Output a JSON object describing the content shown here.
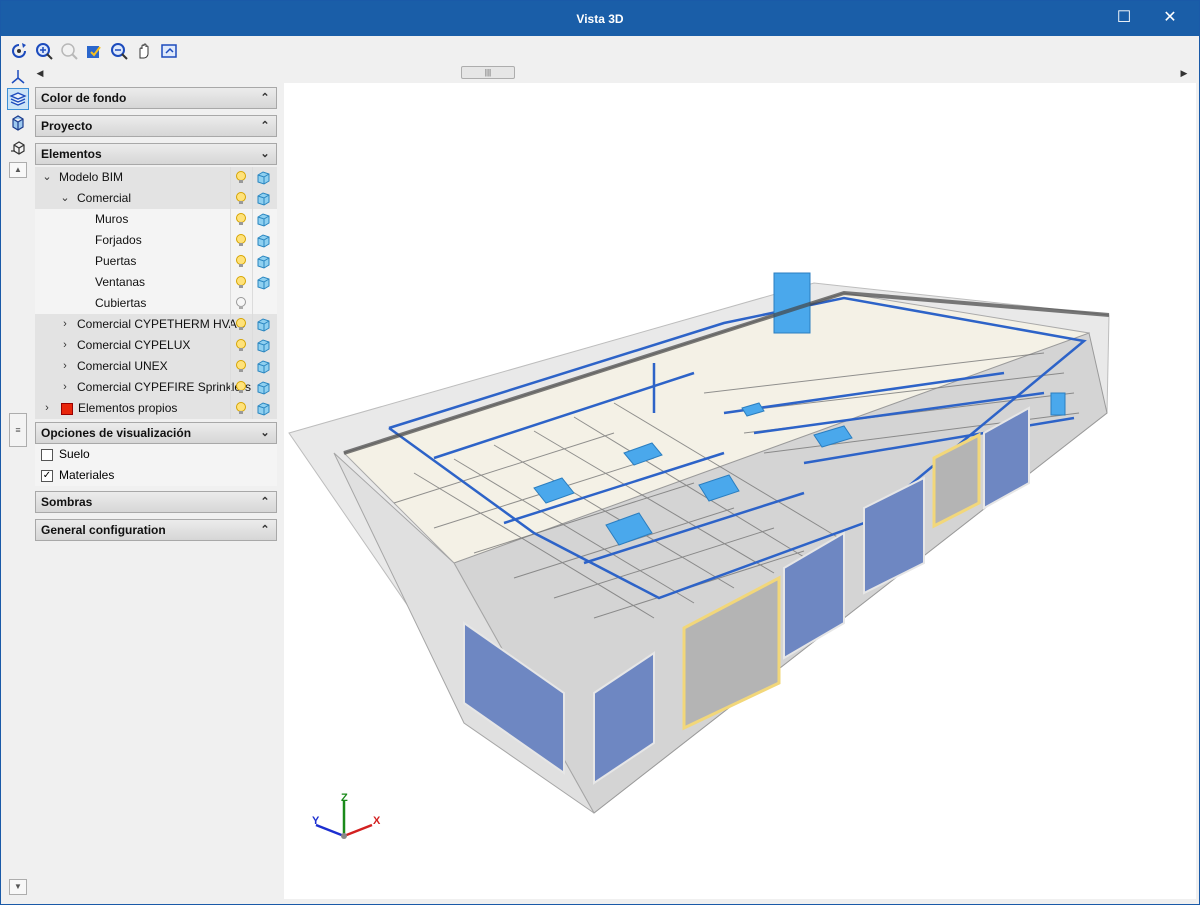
{
  "window": {
    "title": "Vista 3D",
    "maximize_glyph": "☐",
    "close_glyph": "✕"
  },
  "toolbar": {
    "icons": [
      "rotate-icon",
      "zoom-extents-icon",
      "zoom-previous-icon",
      "refresh-view-icon",
      "zoom-window-icon",
      "pan-hand-icon",
      "screenshot-icon"
    ]
  },
  "hscroll": {
    "left_arrow": "◀",
    "right_arrow": "▶",
    "thumb_glyph": "|||"
  },
  "vtools": {
    "icons": [
      "axes-icon",
      "layers-icon",
      "solid-view-icon",
      "object-icon"
    ],
    "up": "▲",
    "mid": "≡",
    "down": "▼"
  },
  "panel": {
    "sections": {
      "background": "Color de fondo",
      "project": "Proyecto",
      "elements": "Elementos",
      "display_options": "Opciones de visualización",
      "shadows": "Sombras",
      "general": "General configuration"
    },
    "chevrons": {
      "up": "⌃",
      "down": "⌄"
    },
    "tree": [
      {
        "label": "Modelo BIM",
        "caret": "⌄",
        "level": 0,
        "bulb": true
      },
      {
        "label": "Comercial",
        "caret": "⌄",
        "level": 1,
        "bulb": true
      },
      {
        "label": "Muros",
        "caret": "",
        "level": 2,
        "bulb": true
      },
      {
        "label": "Forjados",
        "caret": "",
        "level": 2,
        "bulb": true
      },
      {
        "label": "Puertas",
        "caret": "",
        "level": 2,
        "bulb": true
      },
      {
        "label": "Ventanas",
        "caret": "",
        "level": 2,
        "bulb": true
      },
      {
        "label": "Cubiertas",
        "caret": "",
        "level": 2,
        "bulb": false
      },
      {
        "label": "Comercial CYPETHERM HVAC",
        "caret": "›",
        "level": 1,
        "bulb": true
      },
      {
        "label": "Comercial CYPELUX",
        "caret": "›",
        "level": 1,
        "bulb": true
      },
      {
        "label": "Comercial UNEX",
        "caret": "›",
        "level": 1,
        "bulb": true
      },
      {
        "label": "Comercial CYPEFIRE Sprinklers",
        "caret": "›",
        "level": 1,
        "bulb": true
      },
      {
        "label": "Elementos propios",
        "caret": "›",
        "level": 0,
        "bulb": true
      }
    ],
    "options": [
      {
        "label": "Suelo",
        "checked": false,
        "mark": ""
      },
      {
        "label": "Materiales",
        "checked": true,
        "mark": "✓"
      }
    ]
  },
  "viewport": {
    "axis_labels": {
      "x": "X",
      "y": "Y",
      "z": "Z"
    },
    "colors": {
      "axis_x": "#d32020",
      "axis_y": "#1c2fd0",
      "axis_z": "#1a8a1a",
      "duct": "#2d63c8",
      "unit": "#4aa8ec"
    }
  }
}
